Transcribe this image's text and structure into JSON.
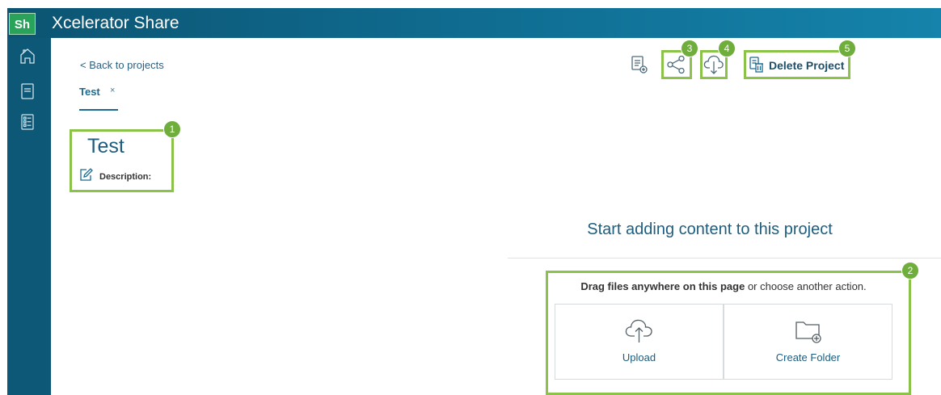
{
  "header": {
    "logo_text": "Sh",
    "app_title": "Xcelerator Share"
  },
  "sidebar": {
    "items": [
      {
        "name": "home",
        "icon": "home-icon"
      },
      {
        "name": "documents",
        "icon": "document-icon"
      },
      {
        "name": "checklist",
        "icon": "checklist-icon"
      }
    ]
  },
  "breadcrumb": {
    "back_label": "< Back to projects"
  },
  "tabs": [
    {
      "label": "Test",
      "close": "×"
    }
  ],
  "project": {
    "title": "Test",
    "description_label": "Description:"
  },
  "toolbar": {
    "new_doc_icon": "new-document-icon",
    "share_icon": "share-icon",
    "download_icon": "cloud-download-icon",
    "delete_label": "Delete Project"
  },
  "callouts": {
    "one": "1",
    "two": "2",
    "three": "3",
    "four": "4",
    "five": "5"
  },
  "content": {
    "empty_heading": "Start adding content to this project",
    "drag_bold": "Drag files anywhere on this page",
    "drag_rest": " or choose another action.",
    "upload_label": "Upload",
    "create_folder_label": "Create Folder"
  },
  "colors": {
    "header": "#0f6a8e",
    "rail": "#0d5876",
    "accent": "#1d6b90",
    "callout": "#8bc34a",
    "logo": "#2aa35a"
  }
}
